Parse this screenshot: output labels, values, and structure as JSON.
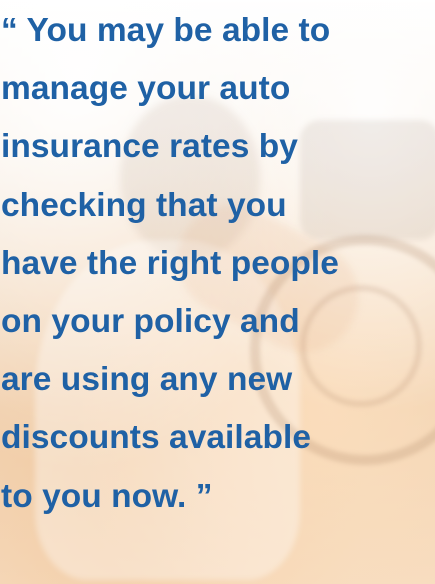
{
  "quote": {
    "lines": [
      "“ You may be able to",
      "manage your auto",
      "insurance rates by",
      "checking that you",
      "have the right people",
      "on your policy and",
      "are using any new",
      "discounts available",
      "to you now. ”"
    ]
  },
  "colors": {
    "text": "#1f61a5",
    "background": "#f3ddc4"
  }
}
